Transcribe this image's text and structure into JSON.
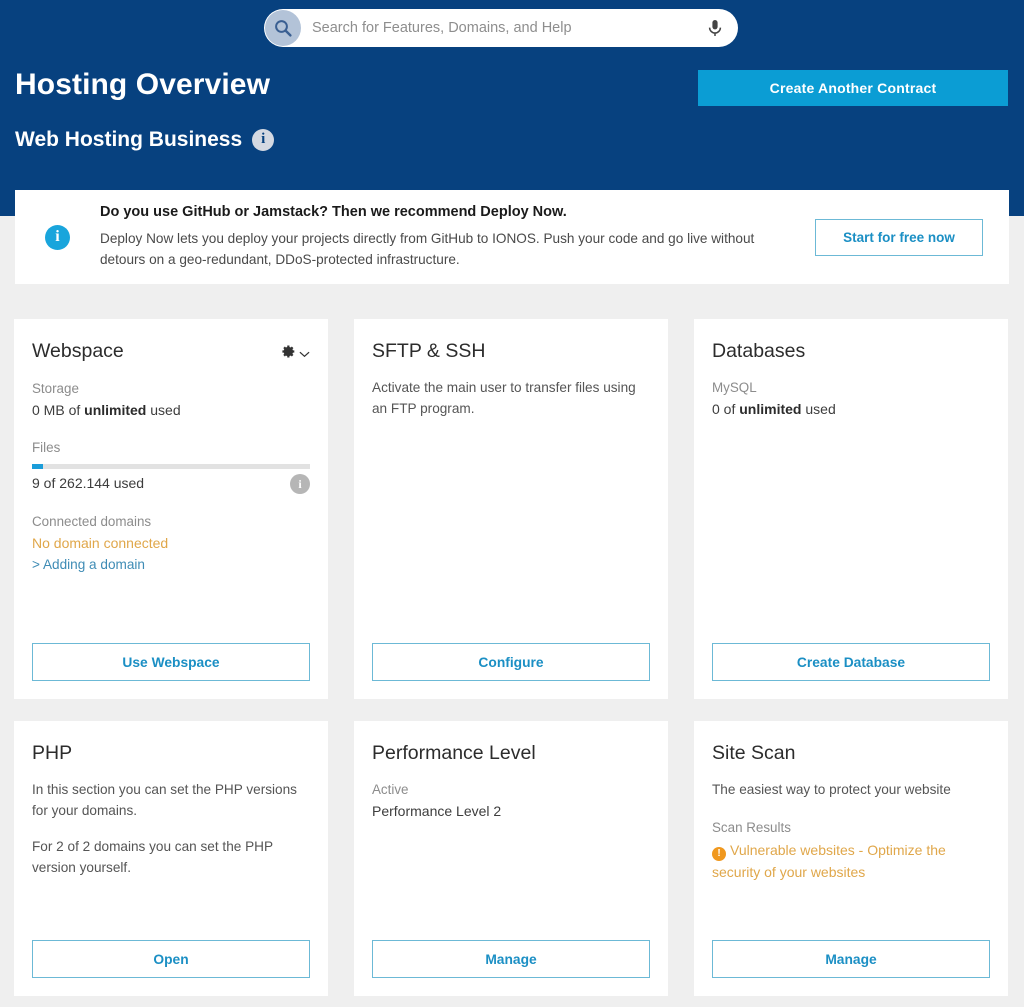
{
  "header": {
    "title": "Hosting Overview",
    "subtitle": "Web Hosting Business",
    "info_icon_char": "i",
    "create_contract_label": "Create Another Contract",
    "background_color": "#07417f",
    "accent_color": "#0b9dd4"
  },
  "search": {
    "placeholder": "Search for Features, Domains, and Help",
    "value": "",
    "search_icon": "search-icon",
    "mic_icon": "microphone-icon"
  },
  "banner": {
    "info_icon_char": "i",
    "headline": "Do you use GitHub or Jamstack? Then we recommend Deploy Now.",
    "body": "Deploy Now lets you deploy your projects directly from GitHub to IONOS. Push your code and go live without detours on a geo-redundant, DDoS-protected infrastructure.",
    "button_label": "Start for free now"
  },
  "cards": {
    "webspace": {
      "title": "Webspace",
      "gear_icon": "gear-icon",
      "chevron_icon": "chevron-down-icon",
      "storage_label": "Storage",
      "storage_value_prefix": "0 MB of ",
      "storage_value_strong": "unlimited",
      "storage_value_suffix": " used",
      "files_label": "Files",
      "files_used_text": "9 of 262.144 used",
      "files_percent": 4,
      "files_info_char": "i",
      "connected_domains_label": "Connected domains",
      "connected_domains_value": "No domain connected",
      "add_domain_link": "Adding a domain",
      "link_chevron": ">",
      "button_label": "Use Webspace"
    },
    "sftp_ssh": {
      "title": "SFTP & SSH",
      "description": "Activate the main user to transfer files using an FTP program.",
      "button_label": "Configure"
    },
    "databases": {
      "title": "Databases",
      "type_label": "MySQL",
      "value_prefix": "0 of ",
      "value_strong": "unlimited",
      "value_suffix": " used",
      "button_label": "Create Database"
    },
    "php": {
      "title": "PHP",
      "description_1": "In this section you can set the PHP versions for your domains.",
      "description_2": "For 2 of 2 domains you can set the PHP version yourself.",
      "button_label": "Open"
    },
    "performance": {
      "title": "Performance Level",
      "status_label": "Active",
      "status_value": "Performance Level 2",
      "button_label": "Manage"
    },
    "site_scan": {
      "title": "Site Scan",
      "description": "The easiest way to protect your website",
      "results_label": "Scan Results",
      "alert_icon_char": "!",
      "alert_text": "Vulnerable websites - Optimize the security of your websites",
      "alert_color": "#e0a74a",
      "button_label": "Manage"
    }
  }
}
